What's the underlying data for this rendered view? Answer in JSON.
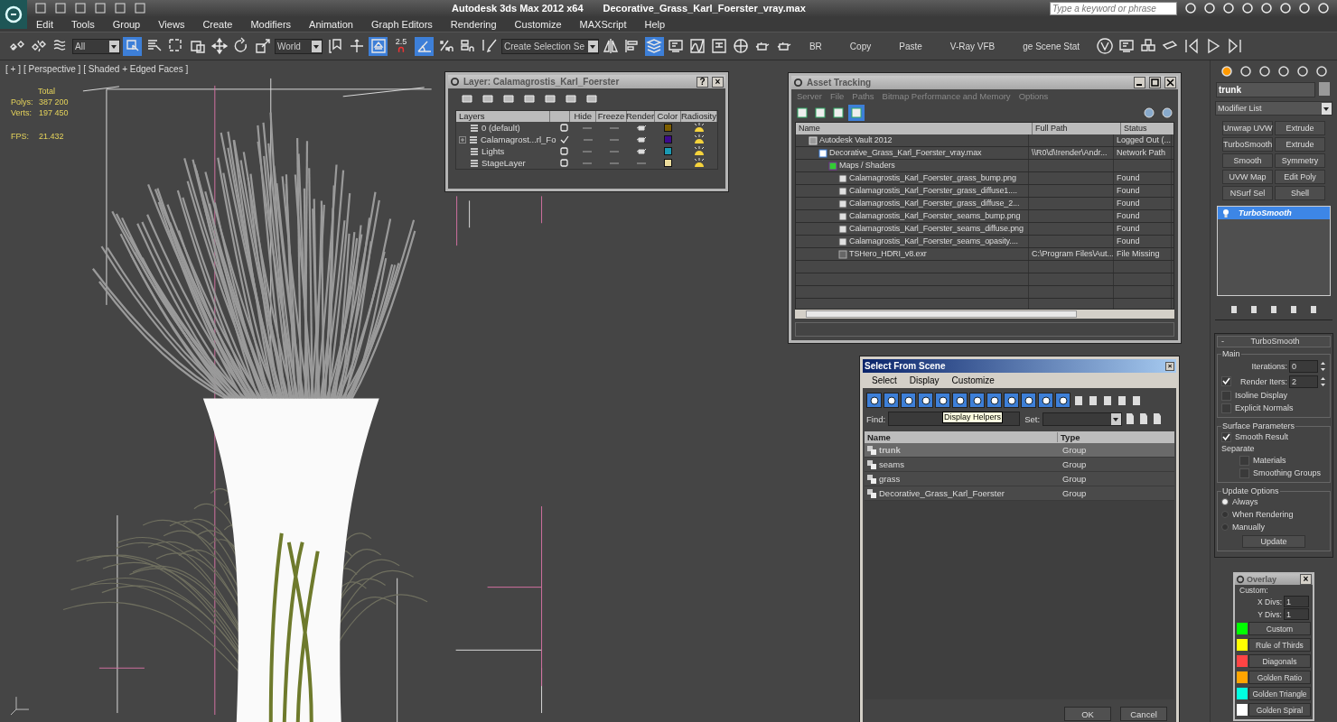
{
  "title_bar": {
    "app": "Autodesk 3ds Max  2012 x64",
    "file": "Decorative_Grass_Karl_Foerster_vray.max",
    "search": {
      "placeholder": "Type a keyword or phrase"
    }
  },
  "menu": [
    "Edit",
    "Tools",
    "Group",
    "Views",
    "Create",
    "Modifiers",
    "Animation",
    "Graph Editors",
    "Rendering",
    "Customize",
    "MAXScript",
    "Help"
  ],
  "toolbar": [
    {
      "kind": "link",
      "on": false
    },
    {
      "kind": "unlink",
      "on": false
    },
    {
      "kind": "bind",
      "on": false
    },
    {
      "kind": "dropdown",
      "value": "All"
    },
    {
      "kind": "select",
      "on": true
    },
    {
      "kind": "selname",
      "on": false
    },
    {
      "kind": "region",
      "on": false
    },
    {
      "kind": "window",
      "on": false
    },
    {
      "kind": "move",
      "on": false
    },
    {
      "kind": "rotate",
      "on": false
    },
    {
      "kind": "scale",
      "on": false
    },
    {
      "kind": "dropdown",
      "value": "World"
    },
    {
      "kind": "pivot",
      "on": false
    },
    {
      "kind": "manip",
      "on": false
    },
    {
      "kind": "keyboard",
      "on": true
    },
    {
      "kind": "snap",
      "value": "2.5",
      "on": false
    },
    {
      "kind": "angle",
      "on": true
    },
    {
      "kind": "percent",
      "on": false
    },
    {
      "kind": "spinner",
      "on": false
    },
    {
      "kind": "edit",
      "on": false
    },
    {
      "kind": "dropdown",
      "value": "Create Selection Se"
    },
    {
      "kind": "mirror",
      "on": false
    },
    {
      "kind": "align",
      "on": false
    },
    {
      "kind": "layers",
      "on": true
    },
    {
      "kind": "render",
      "on": false
    },
    {
      "kind": "curve",
      "on": false
    },
    {
      "kind": "schematic",
      "on": false
    },
    {
      "kind": "material",
      "on": false
    },
    {
      "kind": "teapot",
      "on": false
    },
    {
      "kind": "teapot",
      "on": false
    },
    {
      "kind": "text",
      "value": "BR"
    },
    {
      "kind": "text",
      "value": "Copy"
    },
    {
      "kind": "text",
      "value": "Paste"
    },
    {
      "kind": "text",
      "value": "V-Ray VFB"
    },
    {
      "kind": "labeled",
      "value": "ge Scene Stat"
    },
    {
      "kind": "vray",
      "on": false
    },
    {
      "kind": "render",
      "on": false
    },
    {
      "kind": "boxes",
      "on": false
    },
    {
      "kind": "light",
      "on": false
    },
    {
      "kind": "keyprev",
      "on": false
    },
    {
      "kind": "play",
      "on": false
    },
    {
      "kind": "keynext",
      "on": false
    }
  ],
  "viewport": {
    "labels": [
      "[ + ]",
      "[ Perspective ]",
      "[ Shaded + Edged Faces ]"
    ],
    "stats_title": "Total",
    "stats": [
      {
        "label": "Polys:",
        "value": "387 200"
      },
      {
        "label": "Verts:",
        "value": "197 450"
      },
      {
        "label": "FPS:",
        "value": "21.432"
      }
    ]
  },
  "layer_window": {
    "title": "Layer: Calamagrostis_Karl_Foerster",
    "help": "?",
    "close": "×",
    "columns": [
      "Layers",
      "Hide",
      "Freeze",
      "Render",
      "Color",
      "Radiosity"
    ],
    "rows": [
      {
        "name": "0 (default)",
        "current": false,
        "expandable": false,
        "hidden": false,
        "frozen": false,
        "renderable": true,
        "color": "#7d5e00",
        "radiosity": true
      },
      {
        "name": "Calamagrost...rl_Fo",
        "current": true,
        "expandable": true,
        "hidden": false,
        "frozen": false,
        "renderable": true,
        "color": "#3d0a8c",
        "radiosity": true
      },
      {
        "name": "Lights",
        "current": false,
        "expandable": false,
        "hidden": false,
        "frozen": false,
        "renderable": true,
        "color": "#1b9ab3",
        "radiosity": true
      },
      {
        "name": "StageLayer",
        "current": false,
        "expandable": false,
        "hidden": false,
        "frozen": false,
        "renderable": false,
        "color": "#ecdc9c",
        "radiosity": true
      }
    ]
  },
  "asset_window": {
    "title": "Asset Tracking",
    "menu": [
      {
        "label": "Server",
        "disabled": true
      },
      {
        "label": "File",
        "disabled": true
      },
      {
        "label": "Paths",
        "disabled": true
      },
      {
        "label": "Bitmap Performance and Memory",
        "disabled": true
      },
      {
        "label": "Options",
        "disabled": true
      }
    ],
    "columns": [
      "Name",
      "Full Path",
      "Status"
    ],
    "rows": [
      {
        "kind": "vault",
        "name": "Autodesk Vault 2012",
        "status": "Logged Out (...",
        "children": [
          {
            "kind": "scene",
            "name": "Decorative_Grass_Karl_Foerster_vray.max",
            "path": "\\\\R0\\d\\!render\\Andr...",
            "status": "Network Path",
            "children": [
              {
                "kind": "folder",
                "name": "Maps / Shaders",
                "children": [
                  {
                    "kind": "bitmap",
                    "name": "Calamagrostis_Karl_Foerster_grass_bump.png",
                    "status": "Found"
                  },
                  {
                    "kind": "bitmap",
                    "name": "Calamagrostis_Karl_Foerster_grass_diffuse1....",
                    "status": "Found"
                  },
                  {
                    "kind": "bitmap",
                    "name": "Calamagrostis_Karl_Foerster_grass_diffuse_2...",
                    "status": "Found"
                  },
                  {
                    "kind": "bitmap",
                    "name": "Calamagrostis_Karl_Foerster_seams_bump.png",
                    "status": "Found"
                  },
                  {
                    "kind": "bitmap",
                    "name": "Calamagrostis_Karl_Foerster_seams_diffuse.png",
                    "status": "Found"
                  },
                  {
                    "kind": "bitmap",
                    "name": "Calamagrostis_Karl_Foerster_seams_opasity....",
                    "status": "Found"
                  },
                  {
                    "kind": "missing",
                    "name": "TSHero_HDRI_v8.exr",
                    "path": "C:\\Program Files\\Aut...",
                    "status": "File Missing"
                  }
                ]
              }
            ]
          }
        ]
      }
    ]
  },
  "select_window": {
    "title": "Select From Scene",
    "close": "×",
    "menu": [
      "Select",
      "Display",
      "Customize"
    ],
    "filters": [
      {
        "on": true
      },
      {
        "on": true
      },
      {
        "on": true
      },
      {
        "on": true
      },
      {
        "on": true
      },
      {
        "on": true
      },
      {
        "on": true
      },
      {
        "on": true
      },
      {
        "on": true
      },
      {
        "on": true
      },
      {
        "on": true
      },
      {
        "on": true
      }
    ],
    "find_label": "Find:",
    "set_label": "Set:",
    "tooltip": "Display Helpers",
    "columns": [
      "Name",
      "Type"
    ],
    "rows": [
      {
        "name": "trunk",
        "type": "Group",
        "selected": true
      },
      {
        "name": "seams",
        "type": "Group",
        "selected": false
      },
      {
        "name": "grass",
        "type": "Group",
        "selected": false
      },
      {
        "name": "Decorative_Grass_Karl_Foerster",
        "type": "Group",
        "selected": false
      }
    ],
    "buttons": [
      "OK",
      "Cancel"
    ]
  },
  "command_panel": {
    "object_name": "trunk",
    "modifier_list": "Modifier List",
    "modifier_buttons": [
      "Unwrap UVW",
      "Extrude",
      "TurboSmooth",
      "Extrude",
      "Smooth",
      "Symmetry",
      "UVW Map",
      "Edit Poly",
      "NSurf Sel",
      "Shell"
    ],
    "stack": [
      {
        "name": "TurboSmooth",
        "selected": true
      }
    ],
    "rollout": {
      "title": "TurboSmooth",
      "collapse": "-",
      "main_label": "Main",
      "iterations": {
        "label": "Iterations:",
        "value": "0"
      },
      "render_iters": {
        "label": "Render Iters:",
        "value": "2",
        "checked": true
      },
      "options": [
        {
          "label": "Isoline Display",
          "checked": false
        },
        {
          "label": "Explicit Normals",
          "checked": false
        }
      ],
      "surface_label": "Surface Parameters",
      "smooth_result": {
        "label": "Smooth Result",
        "checked": true
      },
      "separate_label": "Separate",
      "separate": [
        {
          "label": "Materials",
          "checked": false
        },
        {
          "label": "Smoothing Groups",
          "checked": false
        }
      ],
      "update_label": "Update Options",
      "update_options": [
        {
          "label": "Always",
          "selected": true
        },
        {
          "label": "When Rendering",
          "selected": false
        },
        {
          "label": "Manually",
          "selected": false
        }
      ],
      "update_button": "Update"
    }
  },
  "overlay_window": {
    "title": "Overlay",
    "close": "×",
    "custom_label": "Custom:",
    "x_divs": {
      "label": "X Divs:",
      "value": "1"
    },
    "y_divs": {
      "label": "Y Divs:",
      "value": "1"
    },
    "items": [
      {
        "label": "Custom",
        "color": "#00ff00"
      },
      {
        "label": "Rule of Thirds",
        "color": "#ffff00"
      },
      {
        "label": "Diagonals",
        "color": "#ff4444"
      },
      {
        "label": "Golden Ratio",
        "color": "#ffa500"
      },
      {
        "label": "Golden Triangle",
        "color": "#00ffe0"
      },
      {
        "label": "Golden Spiral",
        "color": "#ffffff"
      }
    ]
  }
}
